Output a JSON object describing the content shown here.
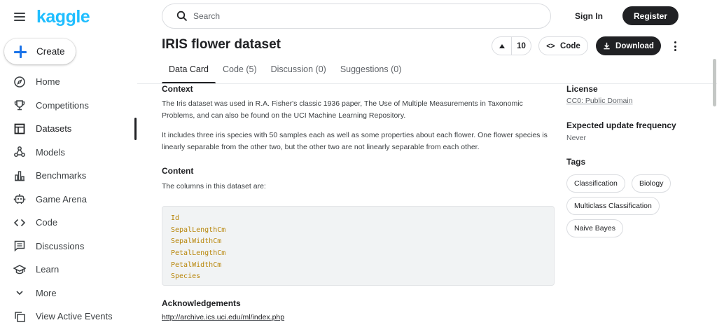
{
  "app": {
    "logo": "kaggle"
  },
  "sidebar": {
    "create_label": "Create",
    "items": [
      {
        "label": "Home",
        "icon": "compass-icon"
      },
      {
        "label": "Competitions",
        "icon": "trophy-icon"
      },
      {
        "label": "Datasets",
        "icon": "table-icon",
        "active": true
      },
      {
        "label": "Models",
        "icon": "models-icon"
      },
      {
        "label": "Benchmarks",
        "icon": "bar-chart-icon"
      },
      {
        "label": "Game Arena",
        "icon": "robot-icon"
      },
      {
        "label": "Code",
        "icon": "code-icon"
      },
      {
        "label": "Discussions",
        "icon": "comment-icon"
      },
      {
        "label": "Learn",
        "icon": "graduation-cap-icon"
      },
      {
        "label": "More",
        "icon": "chevron-down-icon"
      },
      {
        "label": "View Active Events",
        "icon": "copy-icon"
      }
    ]
  },
  "header": {
    "search_placeholder": "Search",
    "signin_label": "Sign In",
    "register_label": "Register"
  },
  "dataset": {
    "title": "IRIS flower dataset",
    "vote_count": "10",
    "code_label": "Code",
    "download_label": "Download"
  },
  "tabs": [
    {
      "label": "Data Card",
      "active": true
    },
    {
      "label": "Code (5)"
    },
    {
      "label": "Discussion (0)"
    },
    {
      "label": "Suggestions (0)"
    }
  ],
  "main": {
    "context_heading": "Context",
    "context_p1": "The Iris dataset was used in R.A. Fisher's classic 1936 paper, The Use of Multiple Measurements in Taxonomic Problems, and can also be found on the UCI Machine Learning Repository.",
    "context_p2": "It includes three iris species with 50 samples each as well as some properties about each flower. One flower species is linearly separable from the other two, but the other two are not linearly separable from each other.",
    "content_heading": "Content",
    "content_p": "The columns in this dataset are:",
    "columns": [
      "Id",
      "SepalLengthCm",
      "SepalWidthCm",
      "PetalLengthCm",
      "PetalWidthCm",
      "Species"
    ],
    "ack_heading": "Acknowledgements",
    "ack_link": "http://archive.ics.uci.edu/ml/index.php"
  },
  "sidebar_right": {
    "license_heading": "License",
    "license_value": "CC0: Public Domain",
    "update_heading": "Expected update frequency",
    "update_value": "Never",
    "tags_heading": "Tags",
    "tags": [
      "Classification",
      "Biology",
      "Multiclass Classification",
      "Naive Bayes"
    ]
  },
  "colors": {
    "brand": "#20beff",
    "dark_button": "#202124",
    "code_text": "#b8860b",
    "plus_icon": "#1a73e8"
  }
}
